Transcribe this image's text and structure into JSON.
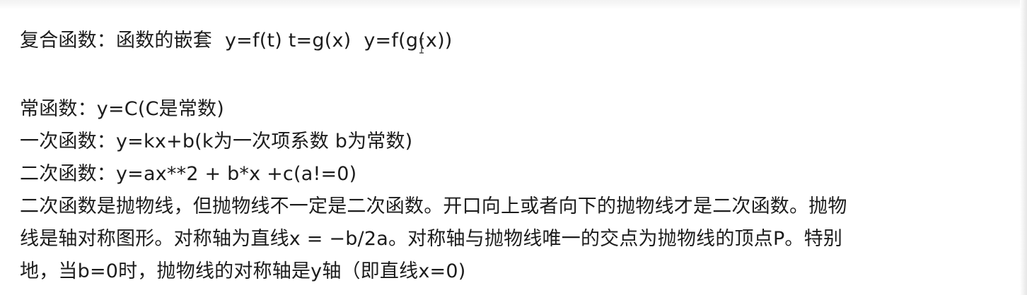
{
  "document": {
    "composite": {
      "heading": "复合函数：函数的嵌套",
      "f1": "y=f(t)",
      "f2": "t=g(x)",
      "f3": "y=f(g(x))"
    },
    "constant_fn": "常函数：y=C(C是常数)",
    "linear_fn": "一次函数：y=kx+b(k为一次项系数 b为常数)",
    "quadratic_fn": "二次函数：y=ax**2 + b*x +c(a!=0)",
    "parabola": {
      "line1": "二次函数是抛物线，但抛物线不一定是二次函数。开口向上或者向下的抛物线才是二次函数。抛物",
      "line2": "线是轴对称图形。对称轴为直线x = −b/2a。对称轴与抛物线唯一的交点为抛物线的顶点P。特别",
      "line3": "地，当b=0时，抛物线的对称轴是y轴（即直线x=0)"
    }
  }
}
